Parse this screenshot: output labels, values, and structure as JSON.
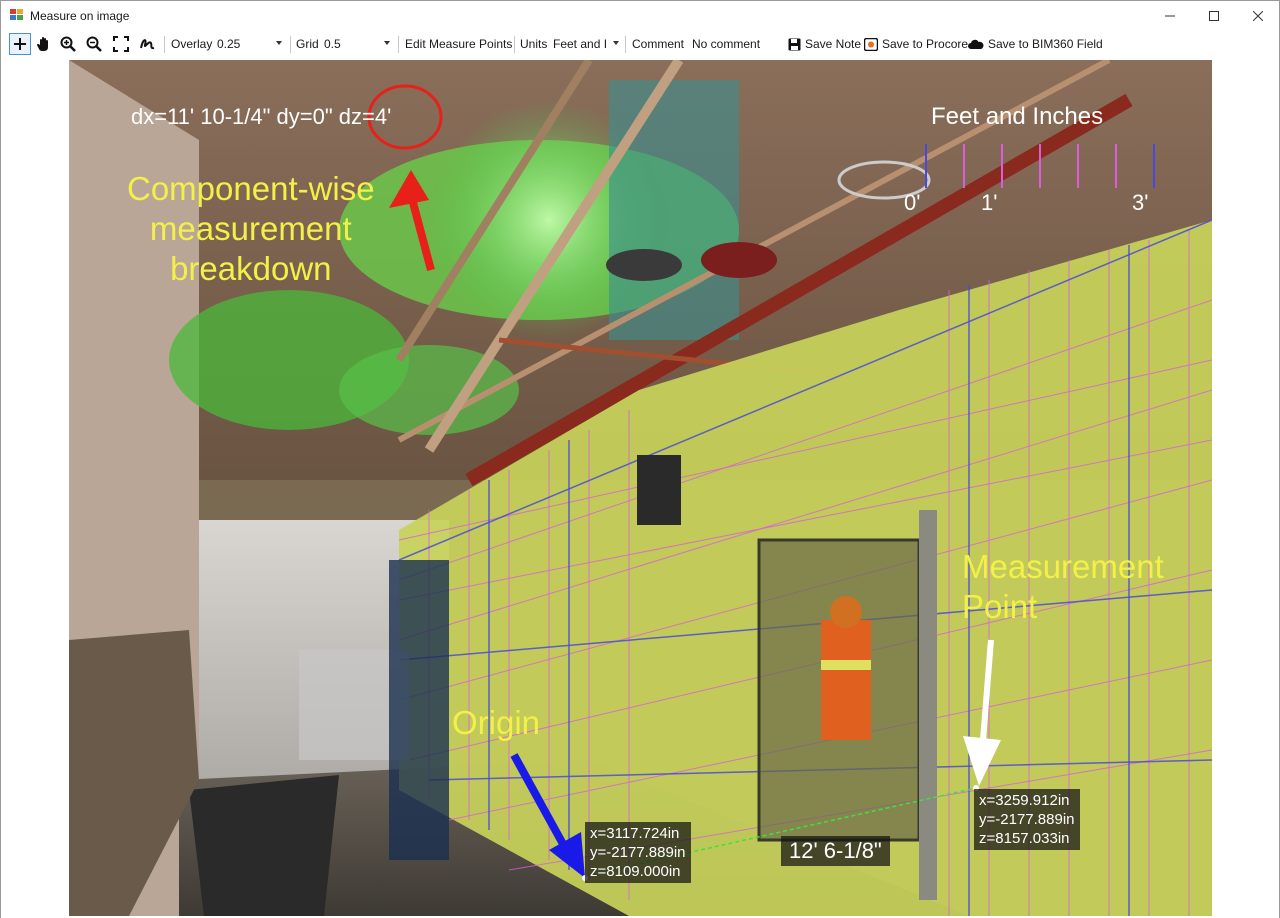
{
  "window": {
    "title": "Measure on image"
  },
  "toolbar": {
    "overlay_label": "Overlay",
    "overlay_value": "0.25",
    "grid_label": "Grid",
    "grid_value": "0.5",
    "edit_measure_points": "Edit Measure Points",
    "units_label": "Units",
    "units_value": "Feet and I",
    "comment_label": "Comment",
    "comment_value": "No comment",
    "save_note": "Save Note",
    "save_procore": "Save to Procore",
    "save_bim360": "Save to BIM360 Field"
  },
  "overlay": {
    "measurement_readout": "dx=11' 10-1/4\" dy=0\" dz=4'",
    "scale_title": "Feet and Inches",
    "scale_ticks": [
      "0'",
      "1'",
      "3'"
    ],
    "annotation_component": "Component-wise\nmeasurement\nbreakdown",
    "annotation_measurement_point": "Measurement\nPoint",
    "annotation_origin": "Origin",
    "origin_coords": {
      "x": "x=3117.724in",
      "y": "y=-2177.889in",
      "z": "z=8109.000in"
    },
    "point_coords": {
      "x": "x=3259.912in",
      "y": "y=-2177.889in",
      "z": "z=8157.033in"
    },
    "distance": "12' 6-1/8\""
  },
  "colors": {
    "annotation_yellow": "#f3f04a",
    "arrow_red": "#e8201a",
    "arrow_blue": "#1a1ae8",
    "arrow_white": "#ffffff",
    "grid_pink": "#d85fd8",
    "grid_blue": "#4a4ad8",
    "wall_overlay": "#c8d25a"
  },
  "icons": [
    "add-point-icon",
    "pan-hand-icon",
    "zoom-in-icon",
    "zoom-out-icon",
    "fit-extents-icon",
    "freehand-icon",
    "save-disk-icon",
    "procore-icon",
    "cloud-icon"
  ]
}
